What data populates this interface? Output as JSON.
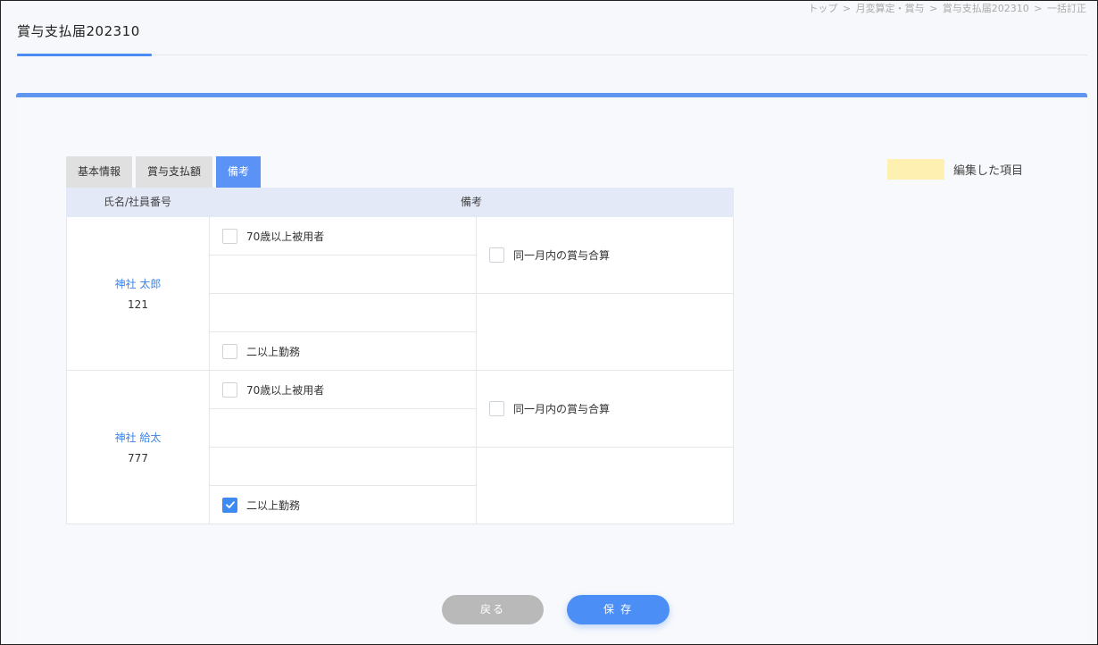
{
  "breadcrumb": [
    "トップ",
    "月変算定・賞与",
    "賞与支払届202310",
    "一括訂正"
  ],
  "breadcrumb_separator": ">",
  "page_title": "賞与支払届202310",
  "tabs": [
    {
      "label": "基本情報",
      "active": false
    },
    {
      "label": "賞与支払額",
      "active": false
    },
    {
      "label": "備考",
      "active": true
    }
  ],
  "legend": {
    "label": "編集した項目",
    "color": "#fdf0b0"
  },
  "table": {
    "headers": {
      "name": "氏名/社員番号",
      "remarks": "備考"
    },
    "rows": [
      {
        "name": "神社 太郎",
        "number": "121",
        "over70": {
          "label": "70歳以上被用者",
          "checked": false
        },
        "multi_work": {
          "label": "二以上勤務",
          "checked": false
        },
        "same_month": {
          "label": "同一月内の賞与合算",
          "checked": false
        }
      },
      {
        "name": "神社 給太",
        "number": "777",
        "over70": {
          "label": "70歳以上被用者",
          "checked": false
        },
        "multi_work": {
          "label": "二以上勤務",
          "checked": true
        },
        "same_month": {
          "label": "同一月内の賞与合算",
          "checked": false
        }
      }
    ]
  },
  "buttons": {
    "back": "戻る",
    "save": "保 存"
  },
  "colors": {
    "accent": "#4b8ff6",
    "tab_active": "#5b92f5",
    "link": "#3c82e6",
    "check": "#3d8bf2"
  }
}
